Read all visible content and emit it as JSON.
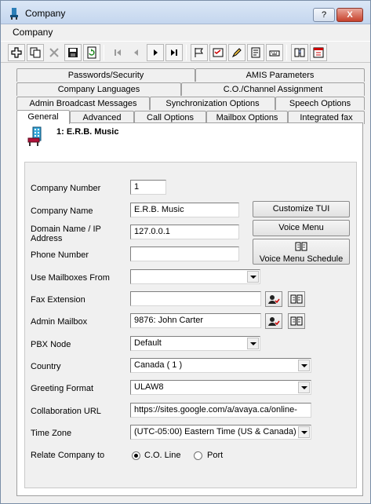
{
  "window": {
    "title": "Company",
    "help_btn": "?",
    "close_btn": "X"
  },
  "menu": {
    "item": "Company"
  },
  "toolbar": {
    "icons": [
      "add-icon",
      "copy-icon",
      "delete-icon",
      "save-icon",
      "refresh-icon",
      "first-icon",
      "prev-icon",
      "next-icon",
      "last-icon",
      "flag-icon",
      "checklist-icon",
      "edit-icon",
      "report-icon",
      "keyboard-icon",
      "help-book-icon",
      "calendar-icon"
    ]
  },
  "tabs": {
    "row1": [
      "Passwords/Security",
      "AMIS Parameters"
    ],
    "row2": [
      "Company Languages",
      "C.O./Channel Assignment"
    ],
    "row3": [
      "Admin Broadcast Messages",
      "Synchronization Options",
      "Speech Options"
    ],
    "row4": [
      "General",
      "Advanced",
      "Call Options",
      "Mailbox Options",
      "Integrated fax"
    ]
  },
  "header": {
    "company": "1: E.R.B. Music"
  },
  "form": {
    "company_number": {
      "label": "Company Number",
      "value": "1"
    },
    "company_name": {
      "label": "Company Name",
      "value": "E.R.B. Music"
    },
    "domain_name": {
      "label": "Domain Name / IP Address",
      "value": "127.0.0.1"
    },
    "phone_number": {
      "label": "Phone Number",
      "value": ""
    },
    "use_mailboxes_from": {
      "label": "Use Mailboxes From",
      "value": ""
    },
    "fax_extension": {
      "label": "Fax Extension",
      "value": ""
    },
    "admin_mailbox": {
      "label": "Admin Mailbox",
      "value": "9876: John Carter"
    },
    "pbx_node": {
      "label": "PBX Node",
      "value": "Default"
    },
    "country": {
      "label": "Country",
      "value": "Canada ( 1 )"
    },
    "greeting_format": {
      "label": "Greeting Format",
      "value": "ULAW8"
    },
    "collaboration_url": {
      "label": "Collaboration URL",
      "value": "https://sites.google.com/a/avaya.ca/online-"
    },
    "time_zone": {
      "label": "Time Zone",
      "value": "(UTC-05:00) Eastern Time (US & Canada)"
    },
    "relate_company_to": {
      "label": "Relate Company to",
      "options": [
        "C.O. Line",
        "Port"
      ],
      "selected": "C.O. Line"
    }
  },
  "buttons": {
    "customize_tui": "Customize TUI",
    "voice_menu": "Voice Menu",
    "voice_menu_schedule": "Voice Menu Schedule"
  }
}
